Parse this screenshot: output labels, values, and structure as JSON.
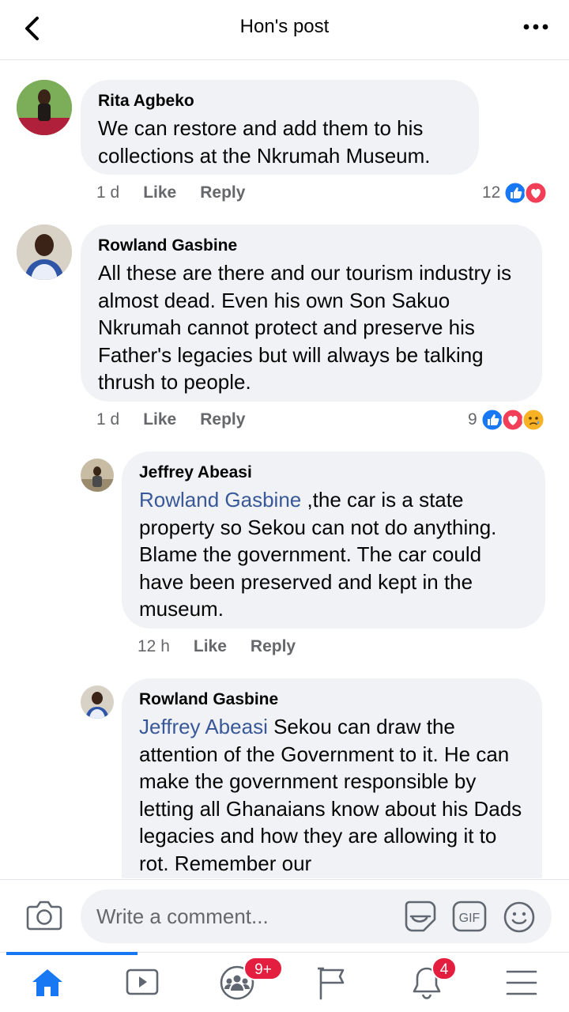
{
  "header": {
    "title": "Hon's post"
  },
  "comments": [
    {
      "author": "Rita Agbeko",
      "text": "We can restore and add them to his collections at the Nkrumah Museum.",
      "time": "1 d",
      "like": "Like",
      "reply": "Reply",
      "reaction_count": "12",
      "reactions": [
        "like-icon",
        "love-icon"
      ]
    },
    {
      "author": "Rowland Gasbine",
      "text": "All these are there and our tourism industry is almost dead.  Even his own Son Sakuo Nkrumah cannot protect and preserve his Father's legacies but will always be talking thrush to people.",
      "time": "1 d",
      "like": "Like",
      "reply": "Reply",
      "reaction_count": "9",
      "reactions": [
        "like-icon",
        "love-icon",
        "sad-icon"
      ]
    }
  ],
  "replies": [
    {
      "author": "Jeffrey Abeasi",
      "mention": "Rowland Gasbine",
      "text": " ,the car is a state property so Sekou can not do anything. Blame the government. The car could have been preserved and kept in the museum.",
      "time": "12 h",
      "like": "Like",
      "reply": "Reply"
    },
    {
      "author": "Rowland Gasbine",
      "mention": "Jeffrey Abeasi",
      "text": " Sekou can draw the attention of the Government to it. He can make the government responsible by letting all Ghanaians know about his Dads legacies and how they are allowing it to rot. Remember our"
    }
  ],
  "composer": {
    "placeholder": "Write a comment..."
  },
  "tabbar": {
    "groups_badge": "9+",
    "notifications_badge": "4"
  },
  "colors": {
    "accent": "#1877f2",
    "bubble": "#f0f2f5",
    "mention": "#385898",
    "badge": "#e41e3f",
    "love": "#f33e58"
  }
}
